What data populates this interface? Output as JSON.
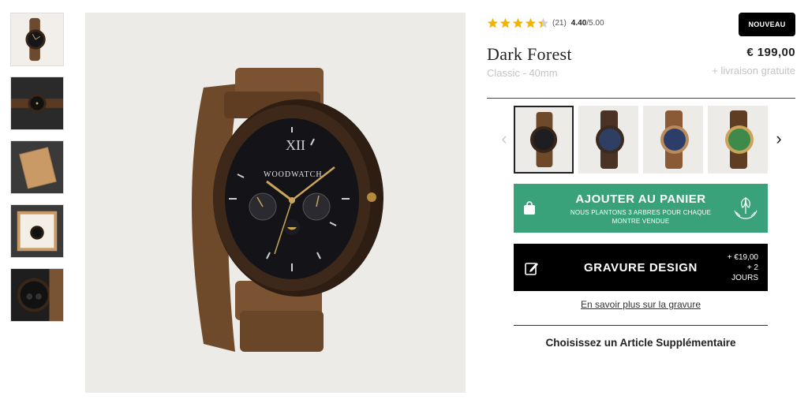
{
  "rating": {
    "stars_filled": 4.4,
    "count": "(21)",
    "score": "4.40",
    "max": "/5.00",
    "star_color": "#f5b400"
  },
  "badge": "NOUVEAU",
  "product": {
    "title": "Dark Forest",
    "subtitle": "Classic - 40mm",
    "price": "€ 199,00",
    "shipping": "+ livraison gratuite"
  },
  "variants": {
    "items": [
      {
        "name": "dark-forest",
        "dial": "#1d1d22"
      },
      {
        "name": "blue-dial",
        "dial": "#2f3e63"
      },
      {
        "name": "navy-rosegold",
        "dial": "#2c3d6a"
      },
      {
        "name": "green-dial",
        "dial": "#3d8a4a"
      }
    ],
    "selected": 0
  },
  "cart": {
    "title": "AJOUTER AU PANIER",
    "subtitle": "NOUS PLANTONS 3 ARBRES POUR CHAQUE MONTRE VENDUE",
    "color": "#3aa27b"
  },
  "engrave": {
    "title": "GRAVURE DESIGN",
    "meta_price": "+ €19,00",
    "meta_days": "+ 2",
    "meta_days_label": "JOURS"
  },
  "learn_more": "En savoir plus sur la gravure",
  "extra_title": "Choisissez un Article Supplémentaire",
  "hero": {
    "brand": "WOODWATCH",
    "numeral": "XII"
  },
  "icons": {
    "prev": "chevron-left-icon",
    "next": "chevron-right-icon",
    "bag": "shopping-bag-icon",
    "tree": "hands-tree-icon",
    "pen": "edit-icon"
  }
}
